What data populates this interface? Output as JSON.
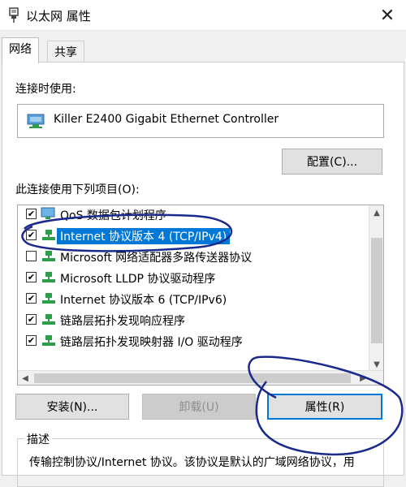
{
  "window": {
    "title": "以太网 属性",
    "close_glyph": "✕"
  },
  "tabs": [
    {
      "label": "网络",
      "active": true
    },
    {
      "label": "共享",
      "active": false
    }
  ],
  "connect_using": {
    "label": "连接时使用:",
    "adapter_name": "Killer E2400 Gigabit Ethernet Controller",
    "adapter_icon": "network-adapter-icon",
    "configure_button": "配置(C)..."
  },
  "items_section": {
    "label": "此连接使用下列项目(O):",
    "items": [
      {
        "label": "QoS 数据包计划程序",
        "checked": true,
        "icon": "qos-icon",
        "selected": false
      },
      {
        "label": "Internet 协议版本 4 (TCP/IPv4)",
        "checked": true,
        "icon": "protocol-icon",
        "selected": true
      },
      {
        "label": "Microsoft 网络适配器多路传送器协议",
        "checked": false,
        "icon": "protocol-icon",
        "selected": false
      },
      {
        "label": "Microsoft LLDP 协议驱动程序",
        "checked": true,
        "icon": "protocol-icon",
        "selected": false
      },
      {
        "label": "Internet 协议版本 6 (TCP/IPv6)",
        "checked": true,
        "icon": "protocol-icon",
        "selected": false
      },
      {
        "label": "链路层拓扑发现响应程序",
        "checked": true,
        "icon": "protocol-icon",
        "selected": false
      },
      {
        "label": "链路层拓扑发现映射器 I/O 驱动程序",
        "checked": true,
        "icon": "protocol-icon",
        "selected": false
      }
    ],
    "check_glyph": "✔"
  },
  "buttons": {
    "install": "安装(N)...",
    "uninstall": "卸载(U)",
    "properties": "属性(R)"
  },
  "description": {
    "legend": "描述",
    "text": "传输控制协议/Internet 协议。该协议是默认的广域网络协议，用"
  },
  "colors": {
    "accent": "#0078d7",
    "annotation": "#1a2a8c"
  }
}
